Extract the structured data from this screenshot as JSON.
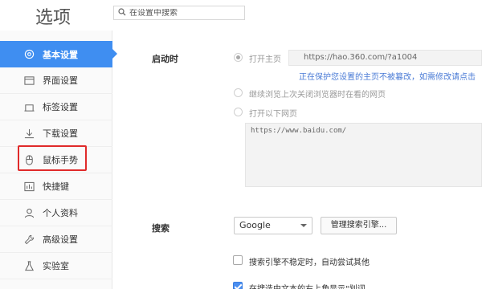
{
  "header": {
    "title": "选项",
    "search_placeholder": "在设置中搜索"
  },
  "sidebar": {
    "items": [
      {
        "label": "基本设置",
        "icon": "gear-icon",
        "active": true
      },
      {
        "label": "界面设置",
        "icon": "window-icon"
      },
      {
        "label": "标签设置",
        "icon": "tab-icon"
      },
      {
        "label": "下载设置",
        "icon": "download-icon"
      },
      {
        "label": "鼠标手势",
        "icon": "mouse-icon",
        "highlighted": true
      },
      {
        "label": "快捷键",
        "icon": "keyboard-icon"
      },
      {
        "label": "个人资料",
        "icon": "user-icon"
      },
      {
        "label": "高级设置",
        "icon": "wrench-icon"
      },
      {
        "label": "实验室",
        "icon": "flask-icon"
      }
    ]
  },
  "startup": {
    "label": "启动时",
    "option_homepage": "打开主页",
    "homepage_url": "https://hao.360.com/?a1004",
    "hint": "正在保护您设置的主页不被篡改，如需修改请点击",
    "option_continue": "继续浏览上次关闭浏览器时在看的网页",
    "option_pages": "打开以下网页",
    "pages_value": "https://www.baidu.com/"
  },
  "search": {
    "label": "搜索",
    "engine_selected": "Google",
    "manage_button": "管理搜索引擎...",
    "check1_label": "搜索引擎不稳定时，自动尝试其他",
    "check2_label": "在搜选中文本的右上角显示\"划词..."
  },
  "colors": {
    "accent": "#3f8ef1",
    "highlight_border": "#e02a2a",
    "hint": "#4a7bd6"
  }
}
